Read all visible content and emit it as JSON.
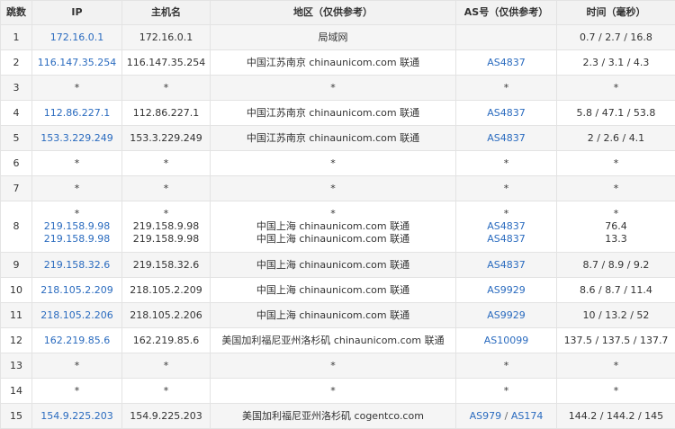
{
  "table": {
    "headers": [
      "跳数",
      "IP",
      "主机名",
      "地区（仅供参考）",
      "AS号（仅供参考）",
      "时间（毫秒）"
    ],
    "rows": [
      {
        "hop": "1",
        "ips": [
          "172.16.0.1"
        ],
        "hosts": [
          "172.16.0.1"
        ],
        "regions": [
          "局域网"
        ],
        "as": [
          []
        ],
        "times": [
          "0.7 / 2.7 / 16.8"
        ]
      },
      {
        "hop": "2",
        "ips": [
          "116.147.35.254"
        ],
        "hosts": [
          "116.147.35.254"
        ],
        "regions": [
          "中国江苏南京 chinaunicom.com 联通"
        ],
        "as": [
          [
            "AS4837"
          ]
        ],
        "times": [
          "2.3 / 3.1 / 4.3"
        ]
      },
      {
        "hop": "3",
        "ips": [
          "*"
        ],
        "hosts": [
          "*"
        ],
        "regions": [
          "*"
        ],
        "as": [
          [
            "*"
          ]
        ],
        "times": [
          "*"
        ]
      },
      {
        "hop": "4",
        "ips": [
          "112.86.227.1"
        ],
        "hosts": [
          "112.86.227.1"
        ],
        "regions": [
          "中国江苏南京 chinaunicom.com 联通"
        ],
        "as": [
          [
            "AS4837"
          ]
        ],
        "times": [
          "5.8 / 47.1 / 53.8"
        ]
      },
      {
        "hop": "5",
        "ips": [
          "153.3.229.249"
        ],
        "hosts": [
          "153.3.229.249"
        ],
        "regions": [
          "中国江苏南京 chinaunicom.com 联通"
        ],
        "as": [
          [
            "AS4837"
          ]
        ],
        "times": [
          "2 / 2.6 / 4.1"
        ]
      },
      {
        "hop": "6",
        "ips": [
          "*"
        ],
        "hosts": [
          "*"
        ],
        "regions": [
          "*"
        ],
        "as": [
          [
            "*"
          ]
        ],
        "times": [
          "*"
        ]
      },
      {
        "hop": "7",
        "ips": [
          "*"
        ],
        "hosts": [
          "*"
        ],
        "regions": [
          "*"
        ],
        "as": [
          [
            "*"
          ]
        ],
        "times": [
          "*"
        ]
      },
      {
        "hop": "8",
        "ips": [
          "*",
          "219.158.9.98",
          "219.158.9.98"
        ],
        "hosts": [
          "*",
          "219.158.9.98",
          "219.158.9.98"
        ],
        "regions": [
          "*",
          "中国上海 chinaunicom.com 联通",
          "中国上海 chinaunicom.com 联通"
        ],
        "as": [
          [
            "*"
          ],
          [
            "AS4837"
          ],
          [
            "AS4837"
          ]
        ],
        "times": [
          "*",
          "76.4",
          "13.3"
        ]
      },
      {
        "hop": "9",
        "ips": [
          "219.158.32.6"
        ],
        "hosts": [
          "219.158.32.6"
        ],
        "regions": [
          "中国上海 chinaunicom.com 联通"
        ],
        "as": [
          [
            "AS4837"
          ]
        ],
        "times": [
          "8.7 / 8.9 / 9.2"
        ]
      },
      {
        "hop": "10",
        "ips": [
          "218.105.2.209"
        ],
        "hosts": [
          "218.105.2.209"
        ],
        "regions": [
          "中国上海 chinaunicom.com 联通"
        ],
        "as": [
          [
            "AS9929"
          ]
        ],
        "times": [
          "8.6 / 8.7 / 11.4"
        ]
      },
      {
        "hop": "11",
        "ips": [
          "218.105.2.206"
        ],
        "hosts": [
          "218.105.2.206"
        ],
        "regions": [
          "中国上海 chinaunicom.com 联通"
        ],
        "as": [
          [
            "AS9929"
          ]
        ],
        "times": [
          "10 / 13.2 / 52"
        ]
      },
      {
        "hop": "12",
        "ips": [
          "162.219.85.6"
        ],
        "hosts": [
          "162.219.85.6"
        ],
        "regions": [
          "美国加利福尼亚州洛杉矶 chinaunicom.com 联通"
        ],
        "as": [
          [
            "AS10099"
          ]
        ],
        "times": [
          "137.5 / 137.5 / 137.7"
        ]
      },
      {
        "hop": "13",
        "ips": [
          "*"
        ],
        "hosts": [
          "*"
        ],
        "regions": [
          "*"
        ],
        "as": [
          [
            "*"
          ]
        ],
        "times": [
          "*"
        ]
      },
      {
        "hop": "14",
        "ips": [
          "*"
        ],
        "hosts": [
          "*"
        ],
        "regions": [
          "*"
        ],
        "as": [
          [
            "*"
          ]
        ],
        "times": [
          "*"
        ]
      },
      {
        "hop": "15",
        "ips": [
          "154.9.225.203"
        ],
        "hosts": [
          "154.9.225.203"
        ],
        "regions": [
          "美国加利福尼亚州洛杉矶 cogentco.com"
        ],
        "as": [
          [
            "AS979",
            "AS174"
          ]
        ],
        "times": [
          "144.2 / 144.2 / 145"
        ]
      }
    ],
    "as_separator": " / "
  },
  "colors": {
    "link": "#2a6bbf",
    "header_bg": "#f2f2f2",
    "stripe_bg": "#f5f5f5",
    "border": "#e3e3e3",
    "text": "#333333"
  }
}
